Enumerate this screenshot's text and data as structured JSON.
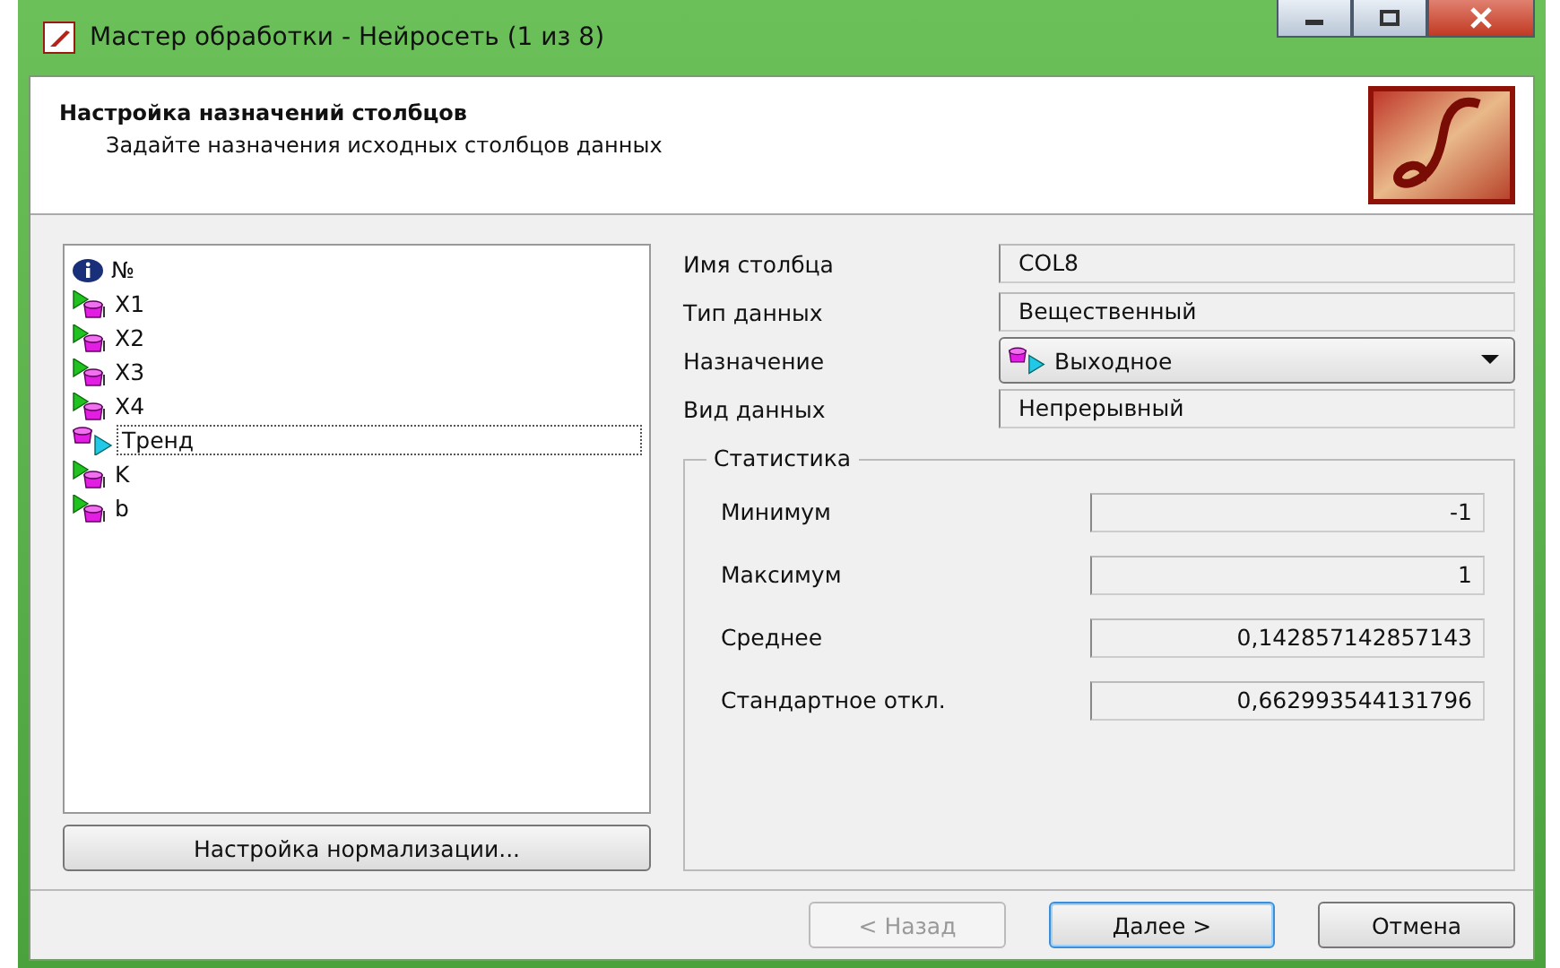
{
  "window": {
    "title": "Мастер обработки - Нейросеть (1 из 8)"
  },
  "header": {
    "title": "Настройка назначений столбцов",
    "subtitle": "Задайте назначения исходных столбцов данных"
  },
  "columns": [
    {
      "label": "№",
      "kind": "info",
      "selected": false
    },
    {
      "label": "X1",
      "kind": "input",
      "selected": false
    },
    {
      "label": "X2",
      "kind": "input",
      "selected": false
    },
    {
      "label": "X3",
      "kind": "input",
      "selected": false
    },
    {
      "label": "X4",
      "kind": "input",
      "selected": false
    },
    {
      "label": "Тренд",
      "kind": "output",
      "selected": true
    },
    {
      "label": "K",
      "kind": "input",
      "selected": false
    },
    {
      "label": "b",
      "kind": "input",
      "selected": false
    }
  ],
  "normalization_button": "Настройка нормализации...",
  "properties": [
    {
      "label": "Имя столбца",
      "value": "COL8",
      "kind": "text"
    },
    {
      "label": "Тип данных",
      "value": "Вещественный",
      "kind": "text"
    },
    {
      "label": "Назначение",
      "value": "Выходное",
      "kind": "dropdown"
    },
    {
      "label": "Вид данных",
      "value": "Непрерывный",
      "kind": "text"
    }
  ],
  "statistics": {
    "title": "Статистика",
    "rows": [
      {
        "label": "Минимум",
        "value": "-1"
      },
      {
        "label": "Максимум",
        "value": "1"
      },
      {
        "label": "Среднее",
        "value": "0,142857142857143"
      },
      {
        "label": "Стандартное откл.",
        "value": "0,662993544131796"
      }
    ]
  },
  "buttons": [
    {
      "label": "< Назад",
      "disabled": true,
      "default": false
    },
    {
      "label": "Далее >",
      "disabled": false,
      "default": true
    },
    {
      "label": "Отмена",
      "disabled": false,
      "default": false
    }
  ]
}
